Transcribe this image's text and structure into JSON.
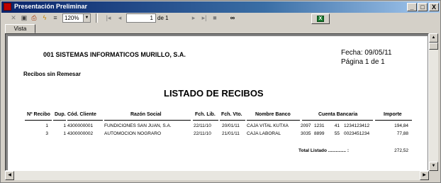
{
  "window": {
    "title": "Presentación Preliminar"
  },
  "caption_buttons": {
    "minimize": "_",
    "maximize": "□",
    "close": "X"
  },
  "toolbar": {
    "zoom_value": "120%",
    "page_value": "1",
    "page_of": "de 1"
  },
  "tabs": [
    {
      "label": "Vista previa"
    }
  ],
  "report": {
    "company": "001  SISTEMAS INFORMATICOS MURILLO, S.A.",
    "date": "Fecha:  09/05/11",
    "page": "Página 1 de 1",
    "subtitle": "Recibos sin Remesar",
    "title": "LISTADO DE RECIBOS",
    "columns": [
      "Nº Recibo",
      "Dup.",
      "Cód. Cliente",
      "Razón Social",
      "Fch. Lib.",
      "Fch. Vto.",
      "Nombre Banco",
      "Cuenta Bancaria",
      "Importe"
    ],
    "rows": [
      {
        "recibo": "1",
        "dup": "1",
        "cliente": "4300000001",
        "razon": "FUNDICIONES SAN JUAN, S.A.",
        "flib": "22/11/10",
        "fvto": "20/01/11",
        "banco": "CAJA VITAL KUTXA",
        "cta1": "2097",
        "cta2": "1231",
        "cta3": "41",
        "cta4": "1234123412",
        "importe": "194,84"
      },
      {
        "recibo": "3",
        "dup": "1",
        "cliente": "4300000002",
        "razon": "AUTOMOCION NOGRARO",
        "flib": "22/11/10",
        "fvto": "21/01/11",
        "banco": "CAJA LABORAL",
        "cta1": "3035",
        "cta2": "8899",
        "cta3": "55",
        "cta4": "0023451234",
        "importe": "77,88"
      }
    ],
    "total_label": "Total Listado .............. :",
    "total_value": "272,52"
  }
}
